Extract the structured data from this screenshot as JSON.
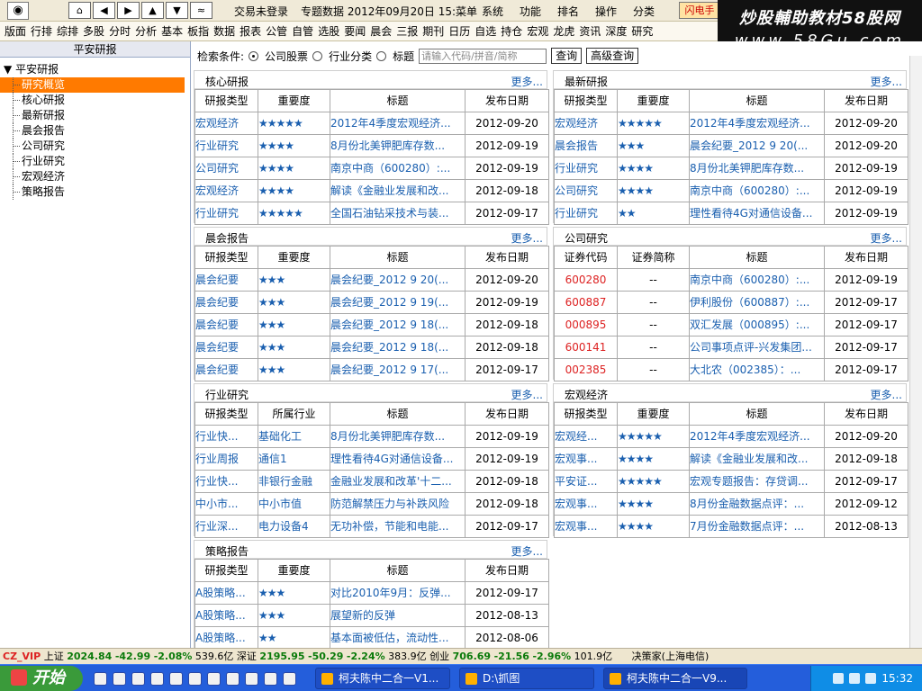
{
  "titlebar": {
    "logo_icon": "app-logo-icon",
    "nav_buttons": [
      "⌂",
      "◀",
      "▶",
      "▲",
      "▼",
      "≈"
    ],
    "status": "交易未登录",
    "date_text": "专题数据 2012年09月20日 15:菜单",
    "menus": [
      "系统",
      "功能",
      "排名",
      "操作",
      "分类"
    ],
    "flash_label": "闪电手"
  },
  "watermark": {
    "line1": "炒股輔助教材58股网",
    "line2": "www.58Gu.com"
  },
  "toolbar": {
    "items": [
      "版面",
      "行排",
      "综排",
      "多股",
      "分时",
      "分析",
      "基本",
      "板指",
      "数据",
      "报表",
      "公管",
      "自管",
      "选股",
      "要闻",
      "晨会",
      "三报",
      "期刊",
      "日历",
      "自选",
      "持仓",
      "宏观",
      "龙虎",
      "资讯",
      "深度",
      "研究"
    ]
  },
  "sidebar": {
    "header": "平安研报",
    "root": "平安研报",
    "items": [
      {
        "label": "研究概览"
      },
      {
        "label": "核心研报"
      },
      {
        "label": "最新研报"
      },
      {
        "label": "晨会报告"
      },
      {
        "label": "公司研究"
      },
      {
        "label": "行业研究"
      },
      {
        "label": "宏观经济"
      },
      {
        "label": "策略报告"
      }
    ]
  },
  "search": {
    "label": "检索条件:",
    "options": [
      "公司股票",
      "行业分类",
      "标题"
    ],
    "placeholder": "请输入代码/拼音/简称",
    "query_button": "查询",
    "advanced_button": "高级查询"
  },
  "more_label": "更多...",
  "panels": {
    "core": {
      "title": "核心研报",
      "headers": [
        "研报类型",
        "重要度",
        "标题",
        "发布日期"
      ],
      "rows": [
        [
          "宏观经济",
          "★★★★★",
          "2012年4季度宏观经济...",
          "2012-09-20"
        ],
        [
          "行业研究",
          "★★★★",
          "8月份北美钾肥库存数...",
          "2012-09-19"
        ],
        [
          "公司研究",
          "★★★★",
          "南京中商（600280）:...",
          "2012-09-19"
        ],
        [
          "宏观经济",
          "★★★★",
          "解读《金融业发展和改...",
          "2012-09-18"
        ],
        [
          "行业研究",
          "★★★★★",
          "全国石油钻采技术与装...",
          "2012-09-17"
        ]
      ]
    },
    "latest": {
      "title": "最新研报",
      "headers": [
        "研报类型",
        "重要度",
        "标题",
        "发布日期"
      ],
      "rows": [
        [
          "宏观经济",
          "★★★★★",
          "2012年4季度宏观经济...",
          "2012-09-20"
        ],
        [
          "晨会报告",
          "★★★",
          "晨会纪要_2012 9 20(...",
          "2012-09-20"
        ],
        [
          "行业研究",
          "★★★★",
          "8月份北美钾肥库存数...",
          "2012-09-19"
        ],
        [
          "公司研究",
          "★★★★",
          "南京中商（600280）:...",
          "2012-09-19"
        ],
        [
          "行业研究",
          "★★",
          "理性看待4G对通信设备...",
          "2012-09-19"
        ]
      ]
    },
    "morning": {
      "title": "晨会报告",
      "headers": [
        "研报类型",
        "重要度",
        "标题",
        "发布日期"
      ],
      "rows": [
        [
          "晨会纪要",
          "★★★",
          "晨会纪要_2012 9 20(...",
          "2012-09-20"
        ],
        [
          "晨会纪要",
          "★★★",
          "晨会纪要_2012 9 19(...",
          "2012-09-19"
        ],
        [
          "晨会纪要",
          "★★★",
          "晨会纪要_2012 9 18(...",
          "2012-09-18"
        ],
        [
          "晨会纪要",
          "★★★",
          "晨会纪要_2012 9 18(...",
          "2012-09-18"
        ],
        [
          "晨会纪要",
          "★★★",
          "晨会纪要_2012 9 17(...",
          "2012-09-17"
        ]
      ]
    },
    "company": {
      "title": "公司研究",
      "headers": [
        "证券代码",
        "证券简称",
        "标题",
        "发布日期"
      ],
      "rows": [
        [
          "600280",
          "--",
          "南京中商（600280）:...",
          "2012-09-19"
        ],
        [
          "600887",
          "--",
          "伊利股份（600887）:...",
          "2012-09-17"
        ],
        [
          "000895",
          "--",
          "双汇发展（000895）:...",
          "2012-09-17"
        ],
        [
          "600141",
          "--",
          "公司事项点评-兴发集团...",
          "2012-09-17"
        ],
        [
          "002385",
          "--",
          "大北农（002385）：...",
          "2012-09-17"
        ]
      ]
    },
    "industry": {
      "title": "行业研究",
      "headers": [
        "研报类型",
        "所属行业",
        "标题",
        "发布日期"
      ],
      "rows": [
        [
          "行业快...",
          "基础化工",
          "8月份北美钾肥库存数...",
          "2012-09-19"
        ],
        [
          "行业周报",
          "通信1",
          "理性看待4G对通信设备...",
          "2012-09-19"
        ],
        [
          "行业快...",
          "非银行金融",
          "金融业发展和改革'十二...",
          "2012-09-18"
        ],
        [
          "中小市...",
          "中小市值",
          "防范解禁压力与补跌风险",
          "2012-09-18"
        ],
        [
          "行业深...",
          "电力设备4",
          "无功补偿，节能和电能...",
          "2012-09-17"
        ]
      ]
    },
    "macro": {
      "title": "宏观经济",
      "headers": [
        "研报类型",
        "重要度",
        "标题",
        "发布日期"
      ],
      "rows": [
        [
          "宏观经...",
          "★★★★★",
          "2012年4季度宏观经济...",
          "2012-09-20"
        ],
        [
          "宏观事...",
          "★★★★",
          "解读《金融业发展和改...",
          "2012-09-18"
        ],
        [
          "平安证...",
          "★★★★★",
          "宏观专题报告：存贷调...",
          "2012-09-17"
        ],
        [
          "宏观事...",
          "★★★★",
          "8月份金融数据点评：...",
          "2012-09-12"
        ],
        [
          "宏观事...",
          "★★★★",
          "7月份金融数据点评：...",
          "2012-08-13"
        ]
      ]
    },
    "strategy": {
      "title": "策略报告",
      "headers": [
        "研报类型",
        "重要度",
        "标题",
        "发布日期"
      ],
      "rows": [
        [
          "A股策略...",
          "★★★",
          "对比2010年9月：反弹...",
          "2012-09-17"
        ],
        [
          "A股策略...",
          "★★★",
          "展望新的反弹",
          "2012-08-13"
        ],
        [
          "A股策略...",
          "★★",
          "基本面被低估，流动性...",
          "2012-08-06"
        ]
      ]
    }
  },
  "statusbar": {
    "vip": "CZ_VIP",
    "sh_name": "上证",
    "sh_value": "2024.84",
    "sh_change": "-42.99",
    "sh_pct": "-2.08%",
    "sh_amount": "539.6亿",
    "sz_name": "深证",
    "sz_value": "2195.95",
    "sz_change": "-50.29",
    "sz_pct": "-2.24%",
    "sz_amount": "383.9亿",
    "cy_name": "创业",
    "cy_value": "706.69",
    "cy_change": "-21.56",
    "cy_pct": "-2.96%",
    "cy_amount": "101.9亿",
    "source": "决策家(上海电信)"
  },
  "taskbar": {
    "start": "开始",
    "tasks": [
      "柯夫陈中二合一V1...",
      "D:\\抓图",
      "柯夫陈中二合一V9..."
    ],
    "time": "15:32"
  },
  "colors": {
    "accent": "#ff7a00",
    "link": "#1a5faf",
    "red": "#d22",
    "green": "#0a7a0a"
  }
}
